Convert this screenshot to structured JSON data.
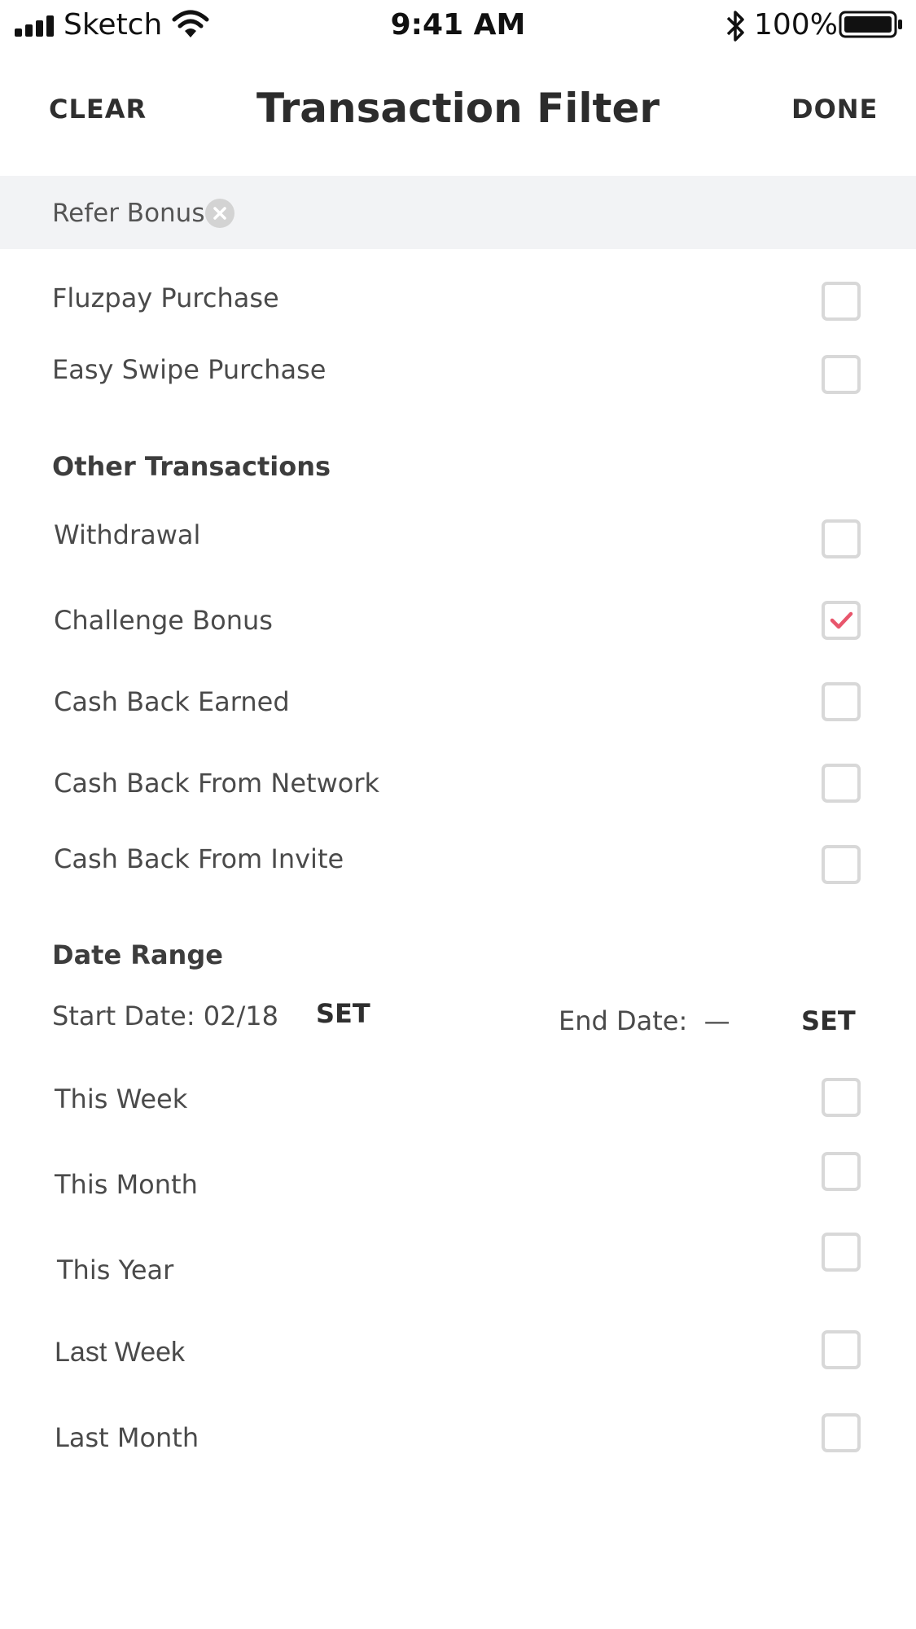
{
  "status_bar": {
    "carrier": "Sketch",
    "time": "9:41 AM",
    "battery_percent": "100%"
  },
  "header": {
    "clear_label": "CLEAR",
    "title": "Transaction Filter",
    "done_label": "DONE"
  },
  "active_filters": [
    {
      "label": "Refer Bonus"
    }
  ],
  "purchase_items": [
    {
      "label": "Fluzpay Purchase",
      "checked": false
    },
    {
      "label": "Easy Swipe Purchase",
      "checked": false
    }
  ],
  "other_transactions": {
    "heading": "Other Transactions",
    "items": [
      {
        "label": "Withdrawal",
        "checked": false
      },
      {
        "label": "Challenge Bonus",
        "checked": true
      },
      {
        "label": "Cash Back Earned",
        "checked": false
      },
      {
        "label": "Cash Back From Network",
        "checked": false
      },
      {
        "label": "Cash Back From Invite",
        "checked": false
      }
    ]
  },
  "date_range": {
    "heading": "Date Range",
    "start_label": "Start Date: 02/18",
    "start_set": "SET",
    "end_label": "End Date:  —",
    "end_set": "SET",
    "presets": [
      {
        "label": "This Week",
        "checked": false
      },
      {
        "label": "This Month",
        "checked": false
      },
      {
        "label": "This Year",
        "checked": false
      },
      {
        "label": "Last Week",
        "checked": false
      },
      {
        "label": "Last Month",
        "checked": false
      }
    ]
  },
  "colors": {
    "accent_check": "#e8566c",
    "chip_bar_bg": "#f2f3f5",
    "checkbox_border": "#d8d8d8"
  },
  "icons": [
    "signal-icon",
    "wifi-icon",
    "bluetooth-icon",
    "battery-icon",
    "remove-chip-icon",
    "checkmark-icon"
  ]
}
